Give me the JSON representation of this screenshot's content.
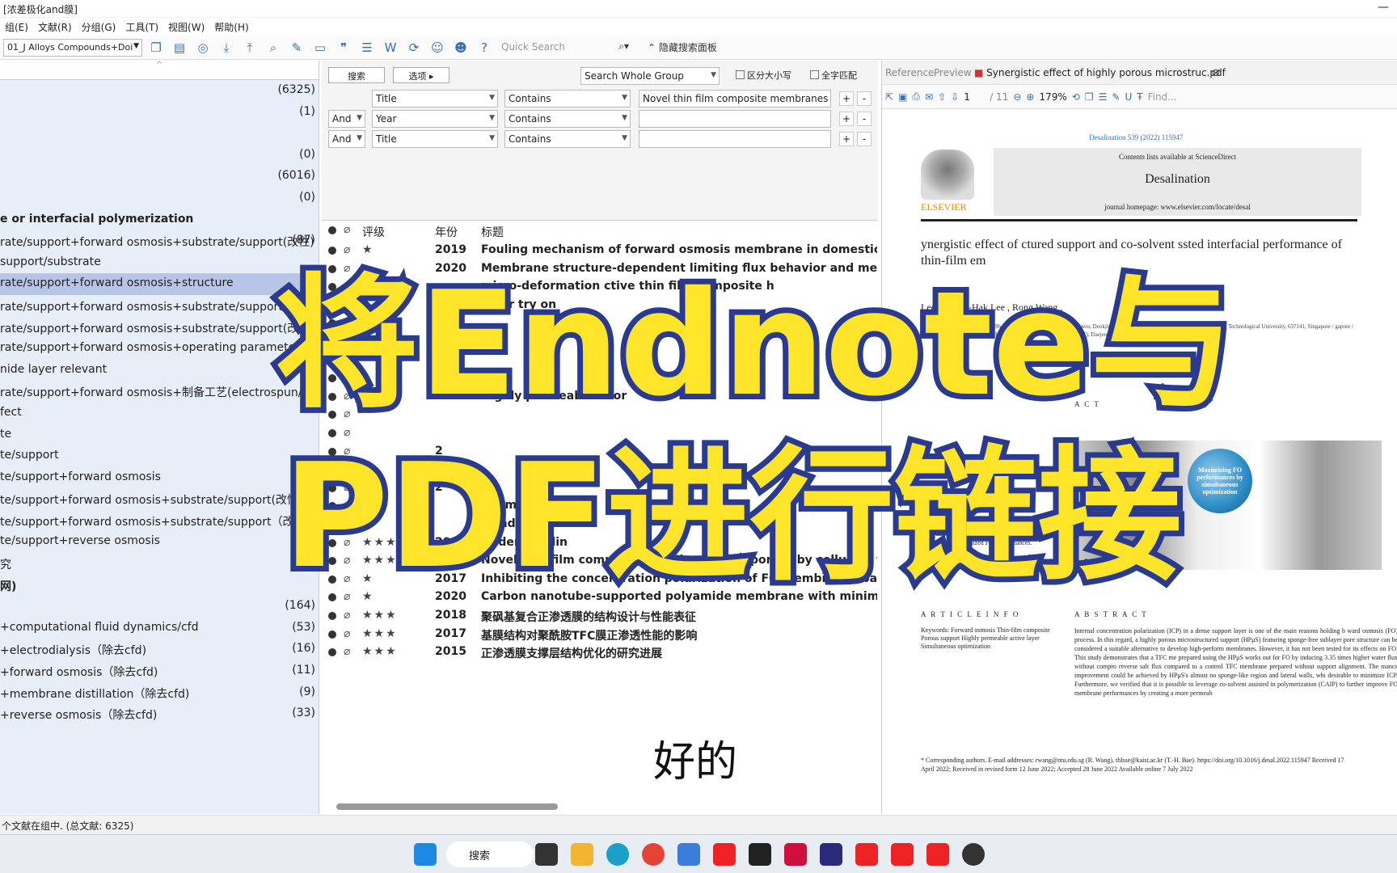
{
  "window": {
    "title": "[浓差极化and膜]"
  },
  "menu": [
    "组(E)",
    "文献(R)",
    "分组(G)",
    "工具(T)",
    "视图(W)",
    "帮助(H)"
  ],
  "toolbar": {
    "library": "01_J Alloys Compounds+Doi",
    "quick_search": "Quick Search",
    "hide_panel": "隐藏搜索面板"
  },
  "groups": [
    {
      "label": "",
      "count": "(6325)"
    },
    {
      "label": "",
      "count": "(1)"
    },
    {
      "label": "",
      "count": ""
    },
    {
      "label": "",
      "count": "(0)"
    },
    {
      "label": "",
      "count": "(6016)"
    },
    {
      "label": "",
      "count": "(0)"
    },
    {
      "label": "e or interfacial polymerization",
      "count": "",
      "bold": true
    },
    {
      "label": "rate/support+forward osmosis+substrate/support(改性)",
      "count": "(87)"
    },
    {
      "label": " support/substrate",
      "count": ""
    },
    {
      "label": "rate/support+forward osmosis+structure",
      "count": "",
      "sel": true
    },
    {
      "label": "rate/support+forward osmosis+substrate/support(改...",
      "count": ""
    },
    {
      "label": "rate/support+forward osmosis+substrate/support(改...",
      "count": ""
    },
    {
      "label": "rate/support+forward osmosis+operating parameter",
      "count": ""
    },
    {
      "label": "nide layer relevant",
      "count": ""
    },
    {
      "label": "rate/support+forward osmosis+制备工艺(electrospun/...",
      "count": ""
    },
    {
      "label": "fect",
      "count": ""
    },
    {
      "label": "te",
      "count": ""
    },
    {
      "label": "te/support",
      "count": ""
    },
    {
      "label": "te/support+forward osmosis",
      "count": ""
    },
    {
      "label": "te/support+forward osmosis+substrate/support(改性",
      "count": ""
    },
    {
      "label": "te/support+forward osmosis+substrate/support（改...",
      "count": ""
    },
    {
      "label": "te/support+reverse osmosis",
      "count": ""
    },
    {
      "label": "究",
      "count": "(2)"
    },
    {
      "label": "网)",
      "count": "",
      "bold": true
    },
    {
      "label": "",
      "count": "(164)"
    },
    {
      "label": "+computational fluid dynamics/cfd",
      "count": "(53)"
    },
    {
      "label": "+electrodialysis（除去cfd)",
      "count": "(16)"
    },
    {
      "label": "+forward osmosis（除去cfd)",
      "count": "(11)"
    },
    {
      "label": "+membrane distillation（除去cfd)",
      "count": "(9)"
    },
    {
      "label": "+reverse osmosis（除去cfd)",
      "count": "(33)"
    }
  ],
  "status": "个文献在组中. (总文献: 6325)",
  "search": {
    "tab1": "搜索",
    "tab2": "选项",
    "scope": "Search Whole Group",
    "case": "区分大小写",
    "whole": "全字匹配",
    "rows": [
      {
        "bool": "",
        "field": "Title",
        "op": "Contains",
        "value": "Novel thin film composite membranes suppo"
      },
      {
        "bool": "And",
        "field": "Year",
        "op": "Contains",
        "value": ""
      },
      {
        "bool": "And",
        "field": "Title",
        "op": "Contains",
        "value": ""
      }
    ]
  },
  "refs": {
    "h_rating": "评级",
    "h_year": "年份",
    "h_title": "标题",
    "rows": [
      {
        "stars": "★",
        "year": "2019",
        "title": "Fouling mechanism of forward osmosis membrane in domestic wastew"
      },
      {
        "stars": "",
        "year": "2020",
        "title": "Membrane structure-dependent limiting flux behavior and membrane"
      },
      {
        "stars": "",
        "year": "",
        "title": "micro-deformation ctive thin film composite h"
      },
      {
        "stars": "",
        "year": "",
        "title": "embr try on"
      },
      {
        "stars": "",
        "year": "",
        "title": ""
      },
      {
        "stars": "",
        "year": "",
        "title": ""
      },
      {
        "stars": "",
        "year": "",
        "title": ""
      },
      {
        "stars": "",
        "year": "",
        "title": ""
      },
      {
        "stars": "",
        "year": "2017",
        "title": "Highly permeab c e for"
      },
      {
        "stars": "",
        "year": "",
        "title": ""
      },
      {
        "stars": "",
        "year": "",
        "title": ""
      },
      {
        "stars": "",
        "year": "2",
        "title": ""
      },
      {
        "stars": "",
        "year": "2",
        "title": ""
      },
      {
        "stars": "",
        "year": "2",
        "title": ""
      },
      {
        "stars": "",
        "year": "",
        "title": "rformance"
      },
      {
        "stars": "",
        "year": "",
        "title": "s and c"
      },
      {
        "stars": "★★★",
        "year": "2014",
        "title": "Understandin"
      },
      {
        "stars": "★★★",
        "year": "2018",
        "title": "Novel thin film composite membranes supported by cellulose triacetat"
      },
      {
        "stars": "★",
        "year": "2017",
        "title": "Inhibiting the concentration polarization of FO membranes based on th"
      },
      {
        "stars": "★",
        "year": "2020",
        "title": "Carbon nanotube-supported polyamide membrane with minimized int"
      },
      {
        "stars": "★★★",
        "year": "2018",
        "title": "聚砜基复合正渗透膜的结构设计与性能表征"
      },
      {
        "stars": "★★★",
        "year": "2017",
        "title": "基膜结构对聚酰胺TFC膜正渗透性能的影响"
      },
      {
        "stars": "★★★",
        "year": "2015",
        "title": "正渗透膜支撑层结构优化的研究进展"
      }
    ]
  },
  "pdf": {
    "tab_ref": "Reference",
    "tab_preview": "Preview",
    "tab_file": "Synergistic effect of highly porous microstruc.pdf",
    "page": "1",
    "pages": "/ 11",
    "zoom": "179%",
    "find": "Find...",
    "doi_top": "Desalination 539 (2022) 115947",
    "contents": "Contents lists available at ScienceDirect",
    "journal": "Desalination",
    "homepage": "journal homepage: www.elsevier.com/locate/desal",
    "elsevier": "ELSEVIER",
    "title": "ynergistic effect of ctured support and co-solvent ssted interfacial performance of thin-film em",
    "authors": "Lee , Chung-Hak Lee , Rong Wang ,",
    "affil": "daero, Deokjin-gu, Jeonju-si 54896, Republic of Korea / 567 Baekje-daero, Deokjin-gu, Jeonju-si 54896, Republic of Korea / Nanyang Technological University, 637141, Singapore / gapore / 7553, Singapore / Seoul 08826, Republic of Korea / Technology (KAIST), Daejeon 34141, Republic of Korea",
    "act": "A C T",
    "graph_globe": "Maximizing FO performances by simultaneous optimization",
    "bullet": "• The simultaneous optimizations of sup- port and active layers maximized FO performances.",
    "article_info": "A R T I C L E  I N F O",
    "keywords": "Keywords: Forward osmosis Thin-film composite Porous support Highly permeable active layer Simultaneous optimization",
    "abstract_h": "A B S T R A C T",
    "abstract": "Internal concentration polarization (ICP) in a dense support layer is one of the main reasons holding b ward osmosis (FO) process. In this regard, a highly porous microstructured support (HPμS) featuring sponge-free sublayer pore structure can be considered a suitable alternative to develop high-perform membranes. However, it has not been tested for its effects on FO. This study demonstrates that a TFC me prepared using the HPμS works out for FO by inducing 3.35 times higher water flux without compro reverse salt flux compared to a control TFC membrane prepared without support alignment. The mance improvement could be achieved by HPμS's almost no sponge-like region and lateral walls, whi desirable to minimize ICP. Furthermore, we verified that it is possible to leverage co-solvent assisted in polymerization (CAIP) to further improve FO membrane performances by creating a more permeab",
    "footer": "* Corresponding authors. E-mail addresses: rwang@ntu.edu.sg (R. Wang), thlsse@kaist.ac.kr (T.-H. Bae). https://doi.org/10.1016/j.desal.2022.115947 Received 17 April 2022; Received in revised form 12 June 2022; Accepted 28 June 2022 Available online 7 July 2022"
  },
  "overlay": {
    "line1": "将Endnote与",
    "line2": "PDF进行链接",
    "caption": "好的"
  },
  "taskbar": {
    "search": "搜索"
  }
}
